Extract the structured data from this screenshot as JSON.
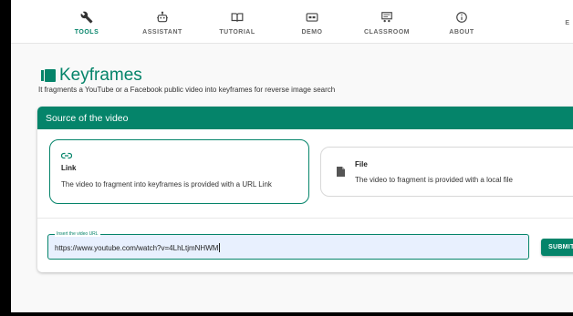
{
  "nav": {
    "items": [
      {
        "label": "TOOLS",
        "icon": "wrench-icon",
        "active": true
      },
      {
        "label": "ASSISTANT",
        "icon": "robot-icon",
        "active": false
      },
      {
        "label": "TUTORIAL",
        "icon": "book-icon",
        "active": false
      },
      {
        "label": "DEMO",
        "icon": "video-icon",
        "active": false
      },
      {
        "label": "CLASSROOM",
        "icon": "classroom-icon",
        "active": false
      },
      {
        "label": "ABOUT",
        "icon": "info-icon",
        "active": false
      }
    ],
    "cut_label": "E"
  },
  "page": {
    "title": "Keyframes",
    "subtitle": "It fragments a YouTube or a Facebook public video into keyframes for reverse image search"
  },
  "source": {
    "header": "Source of the video",
    "options": {
      "link": {
        "title": "Link",
        "description": "The video to fragment into keyframes is provided with a URL Link",
        "icon": "link-icon",
        "selected": true
      },
      "file": {
        "title": "File",
        "description": "The video to fragment is provided with a local file",
        "icon": "file-icon",
        "selected": false
      }
    },
    "url_input": {
      "label": "Insert the video URL",
      "value": "https://www.youtube.com/watch?v=4LhLtjmNHWM"
    },
    "submit_label": "SUBMIT"
  },
  "colors": {
    "accent": "#05846a",
    "input_bg": "#e8f0fe"
  }
}
